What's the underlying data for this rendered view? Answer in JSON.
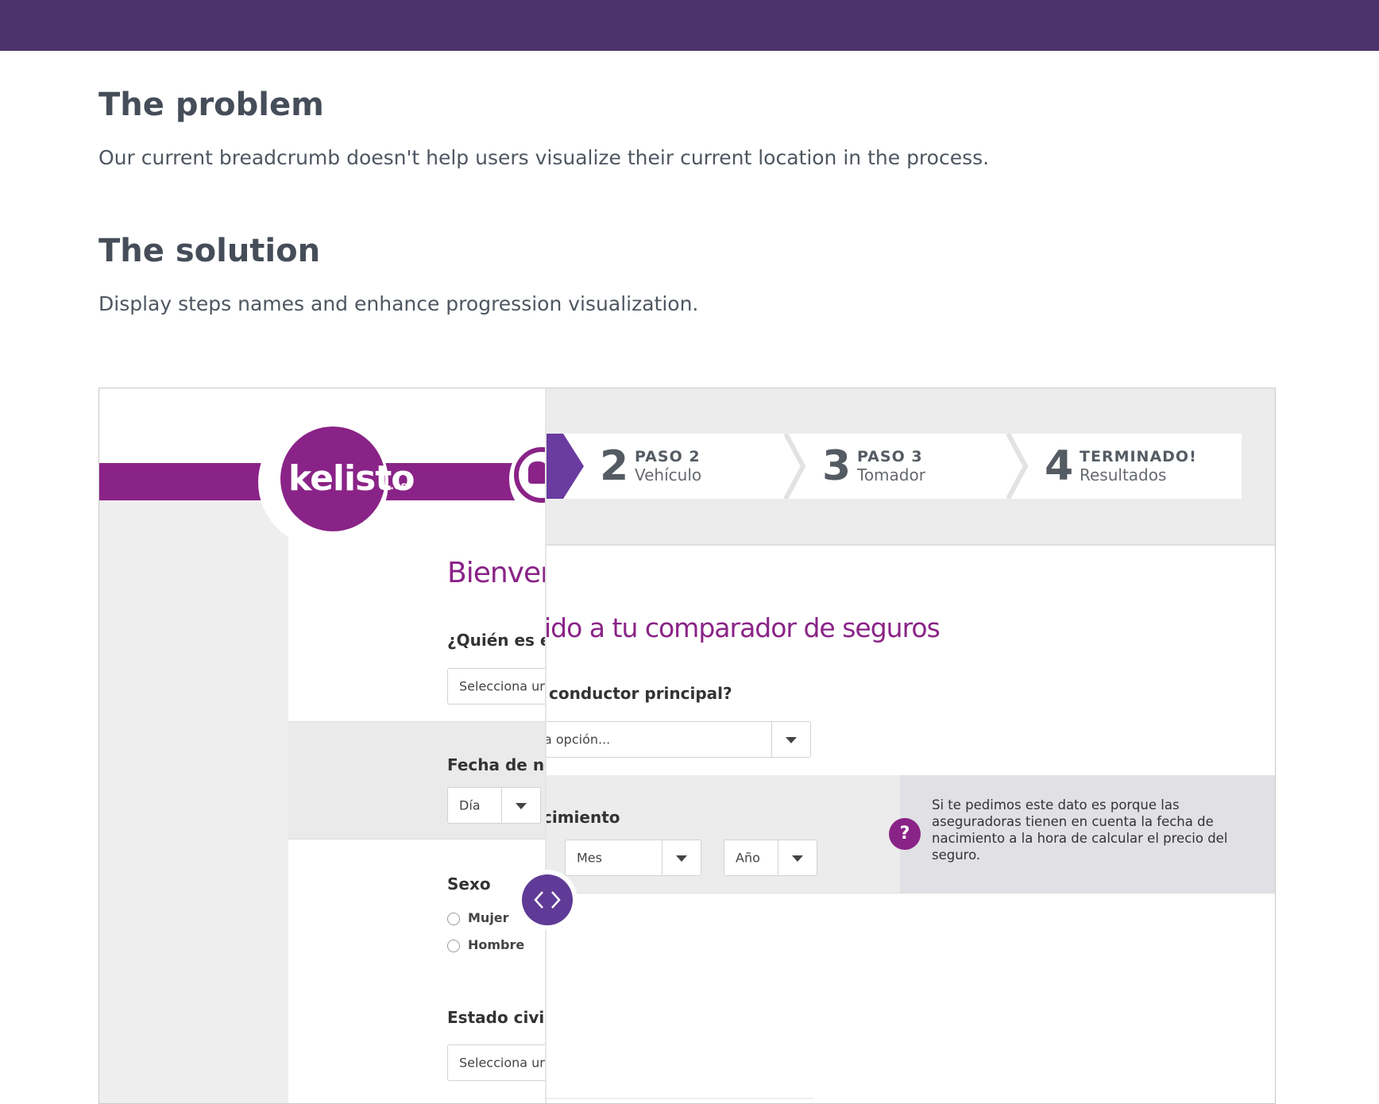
{
  "page": {
    "problem_title": "The problem",
    "problem_text": "Our current breadcrumb doesn't help users visualize their current location in the process.",
    "solution_title": "The solution",
    "solution_text": "Display steps names and enhance progression visualization."
  },
  "colors": {
    "top_bar": "#4d336c",
    "brand_purple": "#8a2387",
    "compare_handle": "#5f3b97",
    "step_arrow": "#6a3ba0",
    "heading_text": "#454d59"
  },
  "old_design": {
    "logo_text": "kelisto",
    "logo_suffix": ".es",
    "welcome_partial": "Bienver",
    "driver_question_partial": "¿Quién es el",
    "driver_select_partial": "Selecciona una",
    "birth_label_partial": "Fecha de na",
    "day_select": "Día",
    "sex_label": "Sexo",
    "sex_options": [
      "Mujer",
      "Hombre"
    ],
    "civil_label": "Estado civil",
    "civil_select_partial": "Selecciona una"
  },
  "new_design": {
    "steps": [
      {
        "number": "2",
        "title": "PASO 2",
        "subtitle": "Vehículo"
      },
      {
        "number": "3",
        "title": "PASO 3",
        "subtitle": "Tomador"
      },
      {
        "number": "4",
        "title": "TERMINADO!",
        "subtitle": "Resultados"
      }
    ],
    "welcome_partial": "ido a tu comparador de seguros",
    "driver_question_partial": "conductor principal?",
    "driver_select_partial": "a opción...",
    "birth_label_partial": "cimiento",
    "month_select": "Mes",
    "year_select": "Año",
    "help_icon": "question-icon",
    "help_text": "Si te pedimos este dato es porque las aseguradoras tienen en cuenta la fecha de nacimiento a la hora de calcular el precio del seguro."
  },
  "compare_handle": {
    "icon": "chevron-left-right-icon"
  }
}
